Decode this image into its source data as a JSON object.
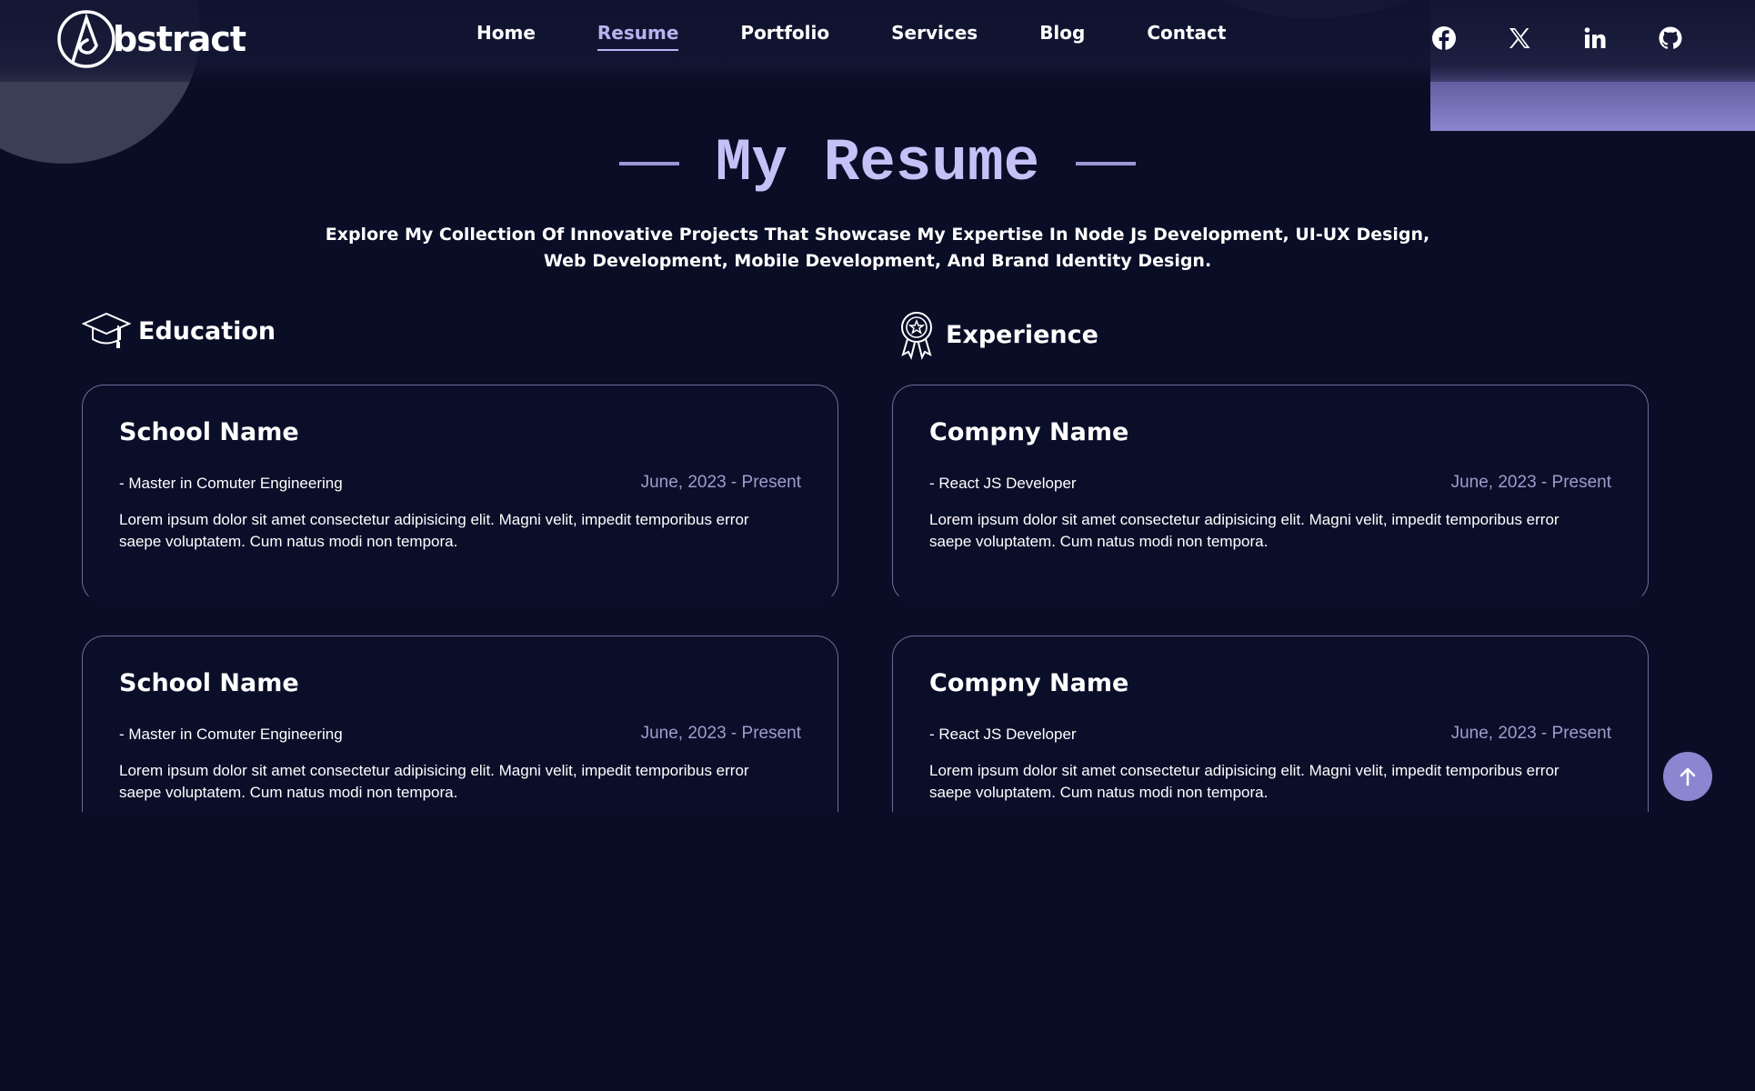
{
  "brand": {
    "logo_text": "bstract"
  },
  "nav": {
    "items": [
      {
        "label": "Home",
        "active": false
      },
      {
        "label": "Resume",
        "active": true
      },
      {
        "label": "Portfolio",
        "active": false
      },
      {
        "label": "Services",
        "active": false
      },
      {
        "label": "Blog",
        "active": false
      },
      {
        "label": "Contact",
        "active": false
      }
    ]
  },
  "socials": [
    "facebook-icon",
    "x-icon",
    "linkedin-icon",
    "github-icon"
  ],
  "hero": {
    "title": "My Resume",
    "subtitle_line1": "Explore My Collection Of Innovative Projects That Showcase My Expertise In Node Js Development, UI-UX Design,",
    "subtitle_line2": "Web Development, Mobile Development, And Brand Identity Design."
  },
  "education": {
    "heading": "Education",
    "items": [
      {
        "name": "School Name",
        "role": "- Master in Comuter Engineering",
        "date": "June, 2023 - Present",
        "desc": "Lorem ipsum dolor sit amet consectetur adipisicing elit. Magni velit, impedit temporibus error saepe voluptatem. Cum natus modi non tempora."
      },
      {
        "name": "School Name",
        "role": "- Master in Comuter Engineering",
        "date": "June, 2023 - Present",
        "desc": "Lorem ipsum dolor sit amet consectetur adipisicing elit. Magni velit, impedit temporibus error saepe voluptatem. Cum natus modi non tempora."
      }
    ]
  },
  "experience": {
    "heading": "Experience",
    "items": [
      {
        "name": "Compny Name",
        "role": "- React JS Developer",
        "date": "June, 2023 - Present",
        "desc": "Lorem ipsum dolor sit amet consectetur adipisicing elit. Magni velit, impedit temporibus error saepe voluptatem. Cum natus modi non tempora."
      },
      {
        "name": "Compny Name",
        "role": "- React JS Developer",
        "date": "June, 2023 - Present",
        "desc": "Lorem ipsum dolor sit amet consectetur adipisicing elit. Magni velit, impedit temporibus error saepe voluptatem. Cum natus modi non tempora."
      }
    ]
  },
  "colors": {
    "background": "#0a0d26",
    "accent": "#b7b3f0",
    "accent_button": "#8b86cf",
    "card_border": "#6f6c98",
    "date_text": "#9f9ccc"
  }
}
